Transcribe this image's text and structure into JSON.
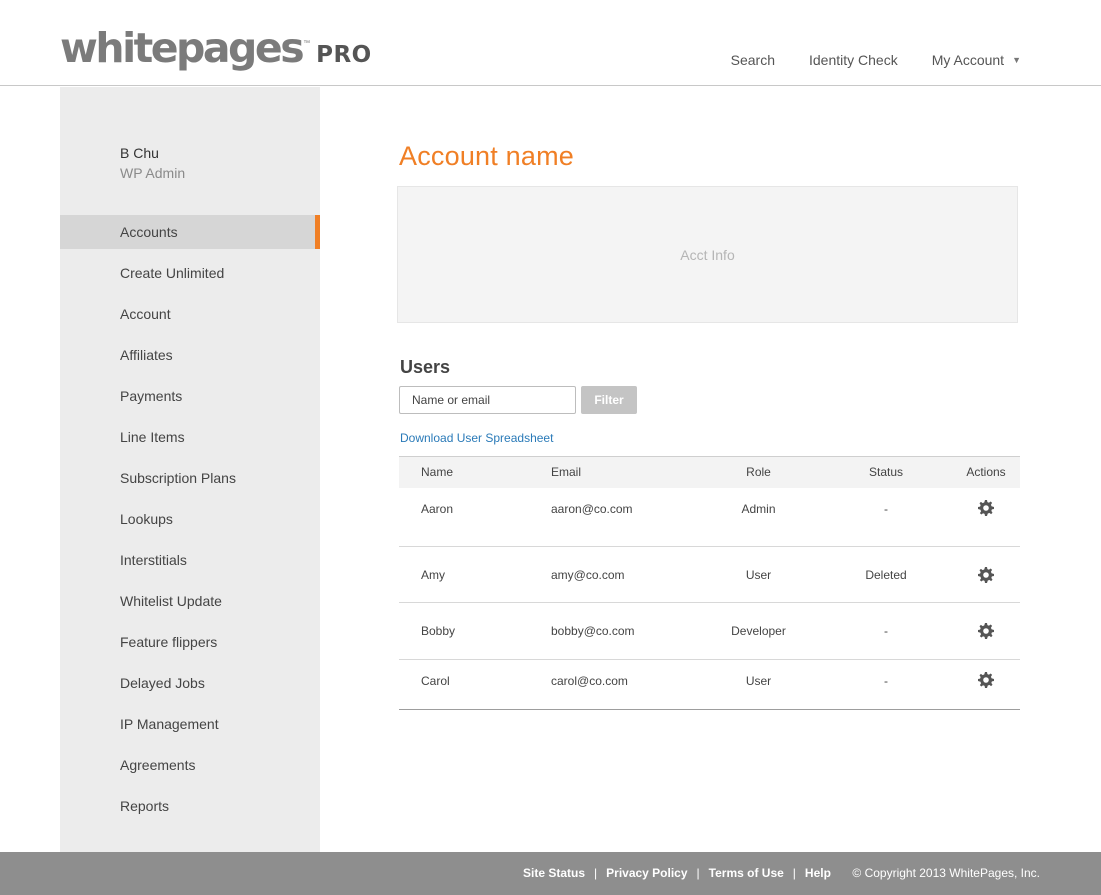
{
  "brand": {
    "logo_word": "whitepages",
    "logo_tm": "™",
    "logo_suffix": "PRO"
  },
  "topnav": {
    "search": "Search",
    "identity_check": "Identity Check",
    "my_account": "My Account"
  },
  "user": {
    "name": "B Chu",
    "role": "WP Admin"
  },
  "sidebar": {
    "items": [
      {
        "label": "Accounts",
        "active": true
      },
      {
        "label": "Create Unlimited"
      },
      {
        "label": "Account"
      },
      {
        "label": "Affiliates"
      },
      {
        "label": "Payments"
      },
      {
        "label": "Line Items"
      },
      {
        "label": "Subscription Plans"
      },
      {
        "label": "Lookups"
      },
      {
        "label": "Interstitials"
      },
      {
        "label": "Whitelist Update"
      },
      {
        "label": "Feature flippers"
      },
      {
        "label": "Delayed Jobs"
      },
      {
        "label": "IP Management"
      },
      {
        "label": "Agreements"
      },
      {
        "label": "Reports"
      }
    ]
  },
  "main": {
    "title": "Account name",
    "acct_info": "Acct Info",
    "users_heading": "Users",
    "search_placeholder": "Name or email",
    "filter_label": "Filter",
    "download_link": "Download User Spreadsheet"
  },
  "table": {
    "headers": {
      "name": "Name",
      "email": "Email",
      "role": "Role",
      "status": "Status",
      "actions": "Actions"
    },
    "rows": [
      {
        "name": "Aaron",
        "email": "aaron@co.com",
        "role": "Admin",
        "status": "-"
      },
      {
        "name": "Amy",
        "email": "amy@co.com",
        "role": "User",
        "status": "Deleted"
      },
      {
        "name": "Bobby",
        "email": "bobby@co.com",
        "role": "Developer",
        "status": "-"
      },
      {
        "name": "Carol",
        "email": "carol@co.com",
        "role": "User",
        "status": "-"
      }
    ],
    "action_icon": "gear-icon"
  },
  "footer": {
    "site_status": "Site Status",
    "privacy_policy": "Privacy Policy",
    "terms_of_use": "Terms of Use",
    "help": "Help",
    "separator": "|",
    "copyright": "© Copyright 2013 WhitePages, Inc."
  },
  "colors": {
    "accent": "#f07f25",
    "link": "#2a7ab8",
    "footer_bg": "#8e8e8e"
  }
}
